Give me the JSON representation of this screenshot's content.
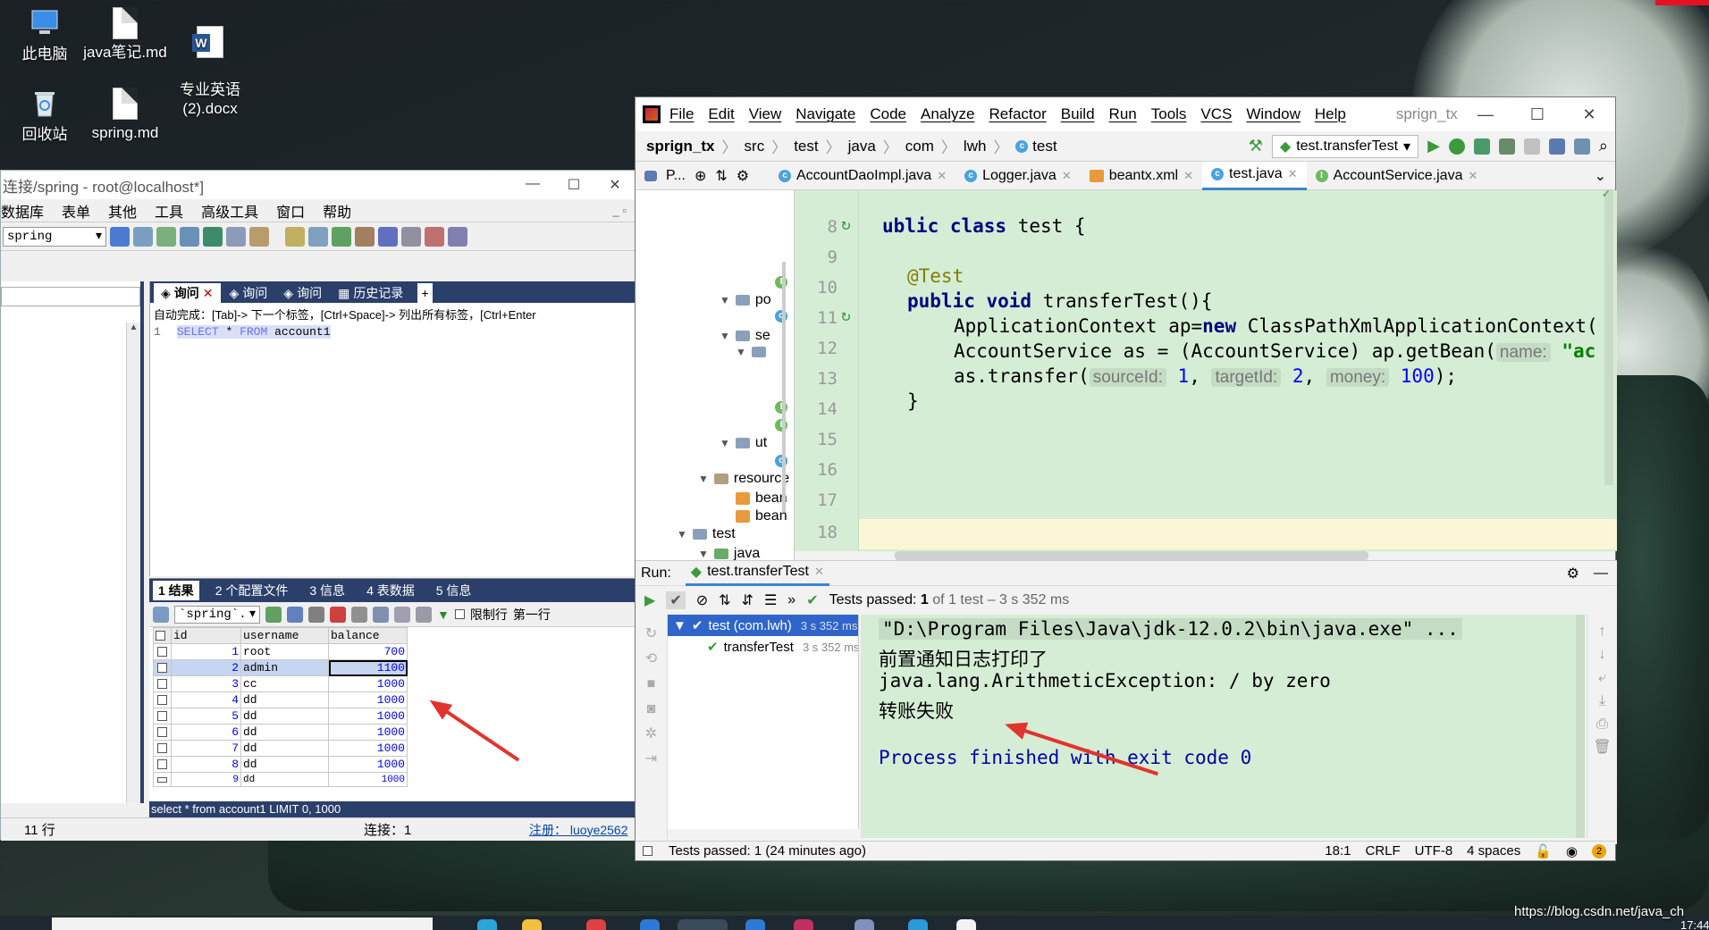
{
  "desktop": {
    "icons": [
      {
        "label": "此电脑",
        "icon": "computer-icon"
      },
      {
        "label": "java笔记.md",
        "icon": "document-icon"
      },
      {
        "label": "专业英语\n(2).docx",
        "icon": "word-icon"
      },
      {
        "label": "回收站",
        "icon": "recycle-bin-icon"
      },
      {
        "label": "spring.md",
        "icon": "document-icon"
      }
    ],
    "watermark": "https://blog.csdn.net/java_ch",
    "clock": "17:44"
  },
  "sql_client": {
    "title": "连接/spring - root@localhost*]",
    "menu": [
      "数据库",
      "表单",
      "其他",
      "工具",
      "高级工具",
      "窗口",
      "帮助"
    ],
    "db_selector": "spring",
    "query_tabs": [
      "询问",
      "询问",
      "询问",
      "历史记录"
    ],
    "hint": "自动完成：[Tab]-> 下一个标签，[Ctrl+Space]-> 列出所有标签，[Ctrl+Enter",
    "sql_line_no": "1",
    "sql_kw1": "SELECT",
    "sql_star": "*",
    "sql_kw2": "FROM",
    "sql_table": "account1",
    "result_tabs": [
      "1 结果",
      "2 个配置文件",
      "3 信息",
      "4 表数据",
      "5 信息"
    ],
    "result_db": "`spring`.",
    "limit_label": "限制行",
    "first_row_label": "第一行",
    "columns": [
      "id",
      "username",
      "balance"
    ],
    "rows": [
      {
        "id": "1",
        "username": "root",
        "balance": "700"
      },
      {
        "id": "2",
        "username": "admin",
        "balance": "1100"
      },
      {
        "id": "3",
        "username": "cc",
        "balance": "1000"
      },
      {
        "id": "4",
        "username": "dd",
        "balance": "1000"
      },
      {
        "id": "5",
        "username": "dd",
        "balance": "1000"
      },
      {
        "id": "6",
        "username": "dd",
        "balance": "1000"
      },
      {
        "id": "7",
        "username": "dd",
        "balance": "1000"
      },
      {
        "id": "8",
        "username": "dd",
        "balance": "1000"
      },
      {
        "id": "9",
        "username": "dd",
        "balance": "1000"
      }
    ],
    "status_sql": "select * from account1 LIMIT 0, 1000",
    "row_count": "11 行",
    "connection": "连接：1",
    "register": "注册：  luoye2562"
  },
  "ide": {
    "menu": [
      "File",
      "Edit",
      "View",
      "Navigate",
      "Code",
      "Analyze",
      "Refactor",
      "Build",
      "Run",
      "Tools",
      "VCS",
      "Window",
      "Help"
    ],
    "project_title": "sprign_tx",
    "breadcrumb": [
      "sprign_tx",
      "src",
      "test",
      "java",
      "com",
      "lwh",
      "test"
    ],
    "run_config": "test.transferTest",
    "project_tab": "P...",
    "editor_tabs": [
      {
        "label": "AccountDaoImpl.java",
        "icon": "class-icon"
      },
      {
        "label": "Logger.java",
        "icon": "class-icon"
      },
      {
        "label": "beantx.xml",
        "icon": "xml-icon"
      },
      {
        "label": "test.java",
        "icon": "class-icon",
        "active": true
      },
      {
        "label": "AccountService.java",
        "icon": "interface-icon"
      }
    ],
    "tree": [
      "po",
      "se",
      "ut",
      "resource",
      "bean",
      "bean",
      "test",
      "java"
    ],
    "line_numbers": [
      "8",
      "9",
      "10",
      "11",
      "12",
      "13",
      "14",
      "15",
      "16",
      "17",
      "18"
    ],
    "code": {
      "l8_kw": "ublic class",
      "l8_rest": " test {",
      "l10": "@Test",
      "l11_kw": "public void",
      "l11_rest": " transferTest(){",
      "l12_a": "ApplicationContext ap=",
      "l12_kw": "new",
      "l12_b": " ClassPathXmlApplicationContext(",
      "l13_a": "AccountService as = (AccountService) ap.getBean(",
      "l13_hint": "name:",
      "l13_str": "\"ac",
      "l14_a": "as.transfer(",
      "l14_h1": "sourceId:",
      "l14_v1": "1",
      "l14_h2": "targetId:",
      "l14_v2": "2",
      "l14_h3": "money:",
      "l14_v3": "100",
      "l14_end": ");",
      "l15": "}"
    },
    "run": {
      "label": "Run:",
      "tab": "test.transferTest",
      "summary_prefix": "Tests passed:",
      "summary_count": "1",
      "summary_rest": "of 1 test – 3 s 352 ms",
      "tree": [
        {
          "label": "test (com.lwh)",
          "time": "3 s 352 ms"
        },
        {
          "label": "transferTest",
          "time": "3 s 352 ms"
        }
      ],
      "console": [
        "\"D:\\Program Files\\Java\\jdk-12.0.2\\bin\\java.exe\" ...",
        "前置通知日志打印了",
        "java.lang.ArithmeticException: / by zero",
        "转账失败",
        "Process finished with exit code 0"
      ]
    },
    "status": {
      "message": "Tests passed: 1 (24 minutes ago)",
      "position": "18:1",
      "line_sep": "CRLF",
      "encoding": "UTF-8",
      "indent": "4 spaces",
      "badge": "2"
    }
  }
}
